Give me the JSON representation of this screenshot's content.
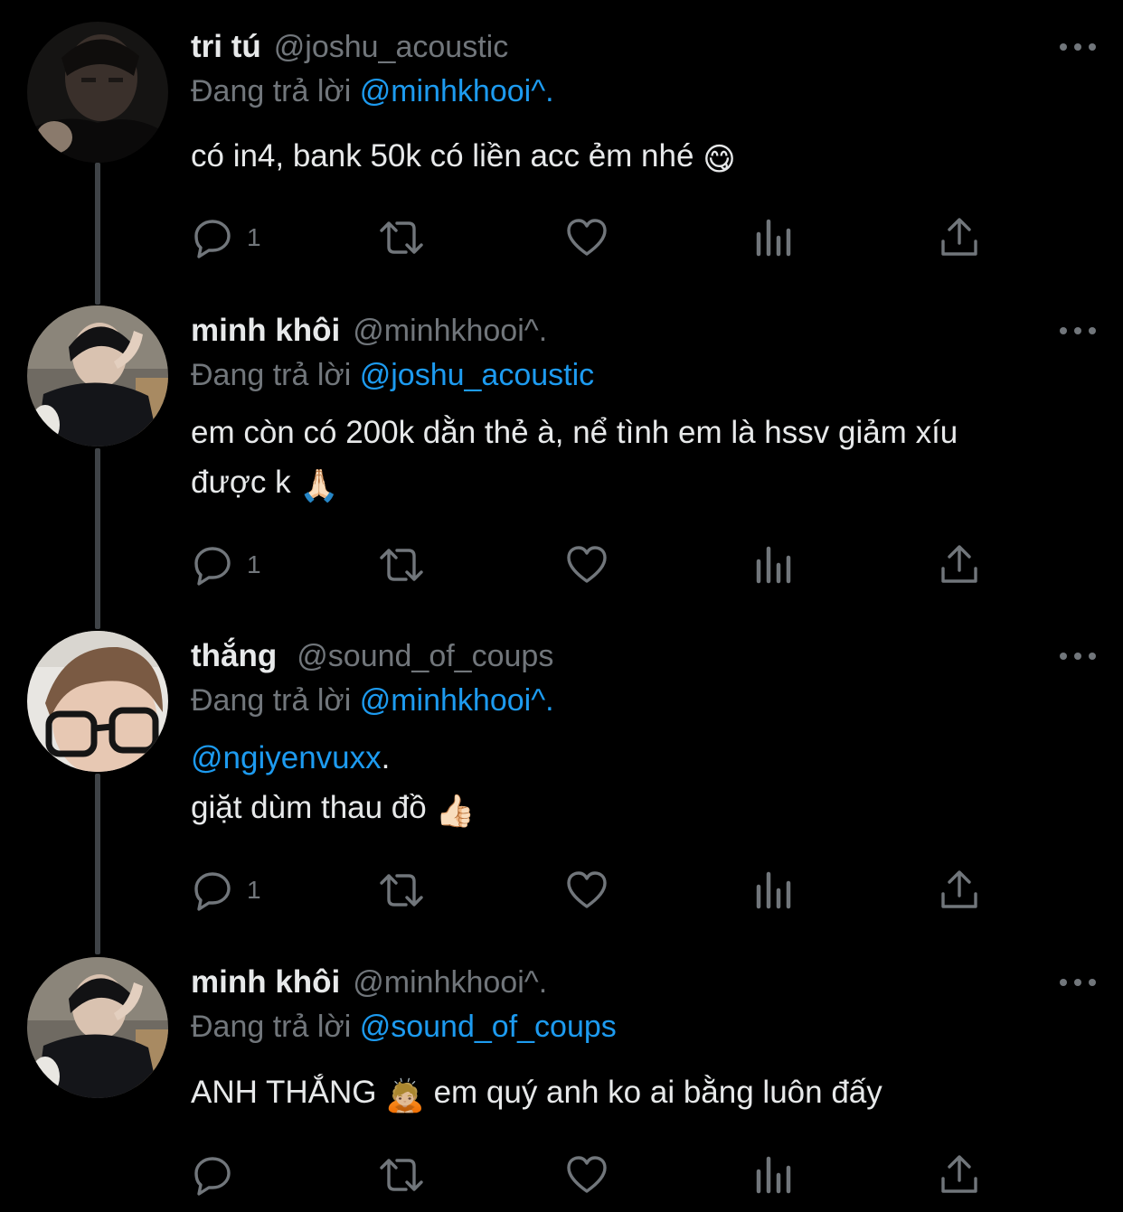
{
  "tweets": [
    {
      "name": "tri tú",
      "handle": "@joshu_acoustic",
      "replying_label": "Đang trả lời",
      "replying_to": "@minhkhooi^.",
      "lines": [
        {
          "text": "có in4, bank 50k có liền acc ẻm nhé",
          "emoji": "😋"
        }
      ],
      "reply_count": "1"
    },
    {
      "name": "minh khôi",
      "handle": "@minhkhooi^.",
      "replying_label": "Đang trả lời",
      "replying_to": "@joshu_acoustic",
      "lines": [
        {
          "text": "em còn có 200k dằn thẻ à, nể tình em là hssv giảm xíu"
        },
        {
          "text": "được k",
          "emoji": "🙏🏻"
        }
      ],
      "reply_count": "1"
    },
    {
      "name": "thắng",
      "handle": "@sound_of_coups",
      "replying_label": "Đang trả lời",
      "replying_to": "@minhkhooi^.",
      "mention_line": {
        "mention": "@ngiyenvuxx",
        "suffix": "."
      },
      "lines": [
        {
          "text": "giặt dùm thau đồ",
          "emoji": "👍🏻"
        }
      ],
      "reply_count": "1"
    },
    {
      "name": "minh khôi",
      "handle": "@minhkhooi^.",
      "replying_label": "Đang trả lời",
      "replying_to": "@sound_of_coups",
      "lines": [
        {
          "text": "ANH THẮNG",
          "emoji": "🙇🏼",
          "after": "em quý anh ko ai bằng luôn đấy"
        }
      ],
      "reply_count": ""
    }
  ],
  "icons": {
    "reply": "reply-icon",
    "retweet": "retweet-icon",
    "like": "heart-icon",
    "views": "views-icon",
    "share": "share-icon",
    "more": "more-icon"
  },
  "colors": {
    "background": "#000000",
    "text": "#e7e9ea",
    "muted": "#71767b",
    "mention": "#1d9bf0"
  }
}
